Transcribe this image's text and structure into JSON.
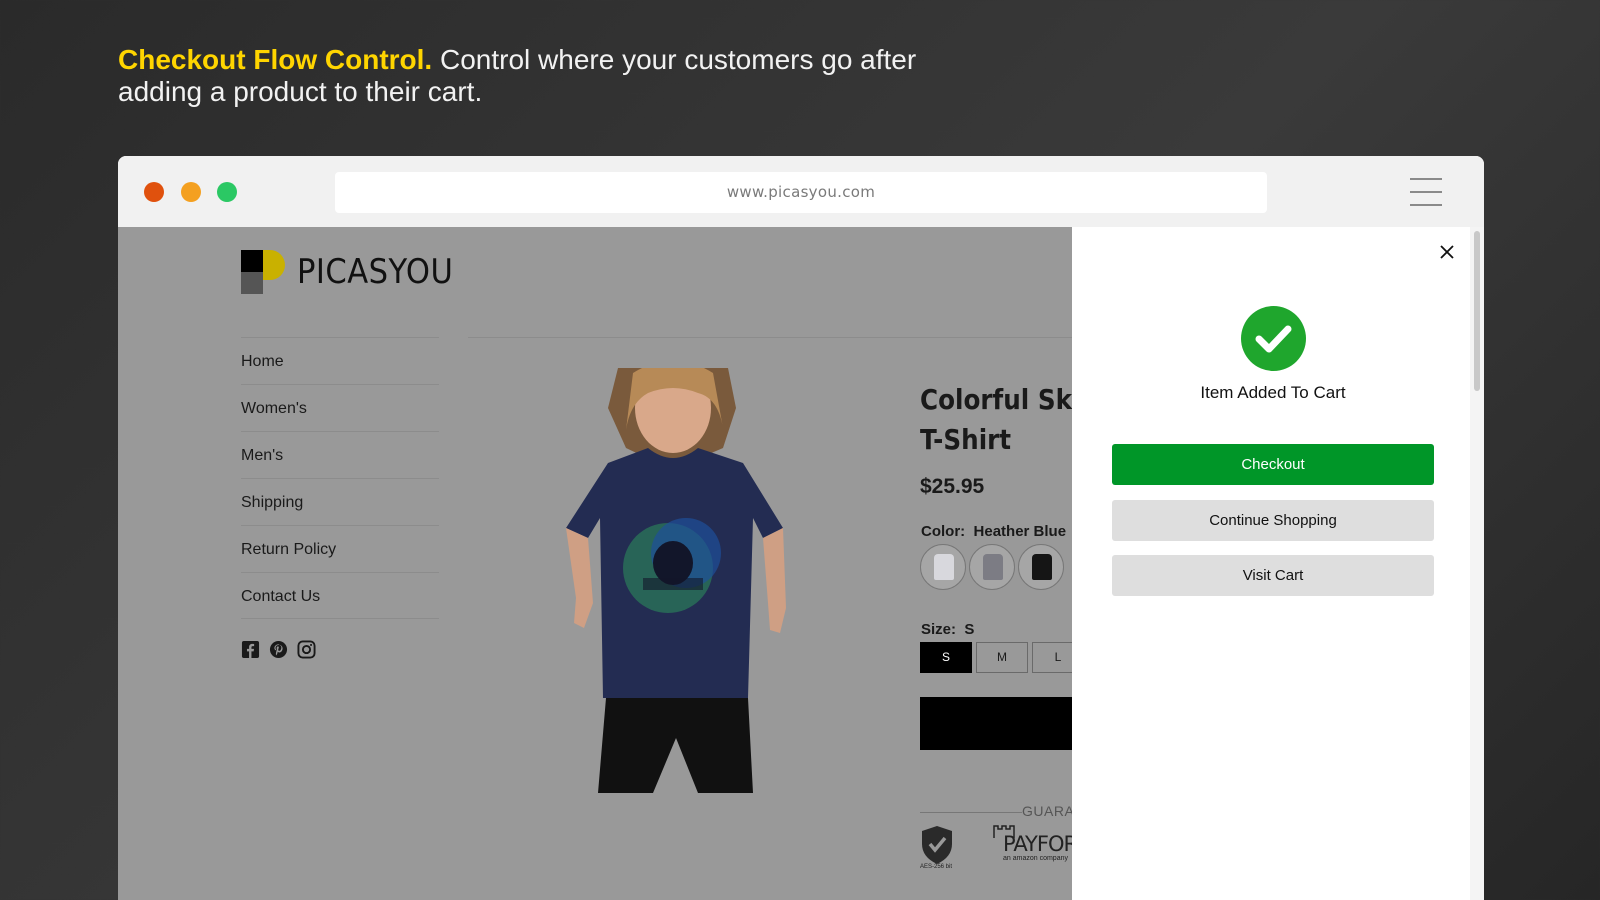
{
  "headline": {
    "accent": "Checkout Flow Control.",
    "text": "Control where your customers go after adding a product to their cart."
  },
  "browser": {
    "url": "www.picasyou.com",
    "controls": [
      "close-dot",
      "minimize-dot",
      "maximize-dot"
    ]
  },
  "store": {
    "logo_text": "PICASYOU",
    "nav": [
      "Home",
      "Women's",
      "Men's",
      "Shipping",
      "Return Policy",
      "Contact Us"
    ],
    "social_icons": [
      "facebook-icon",
      "pinterest-icon",
      "instagram-icon"
    ]
  },
  "product": {
    "title_line1": "Colorful Skul",
    "title_line2": "T-Shirt",
    "price": "$25.95",
    "color_label": "Color:",
    "color_value": "Heather Blue",
    "size_label": "Size:",
    "size_value": "S",
    "sizes": [
      "S",
      "M",
      "L"
    ],
    "guarantee_text": "GUARA",
    "badge_caption": "AES-256 bit",
    "payfort_name": "PAYFORT",
    "payfort_sub": "an amazon company"
  },
  "drawer": {
    "message": "Item Added To Cart",
    "checkout_label": "Checkout",
    "continue_label": "Continue Shopping",
    "visit_cart_label": "Visit Cart"
  },
  "colors": {
    "accent_yellow": "#ffd500",
    "checkout_green": "#009628",
    "success_green": "#1fa62d"
  }
}
